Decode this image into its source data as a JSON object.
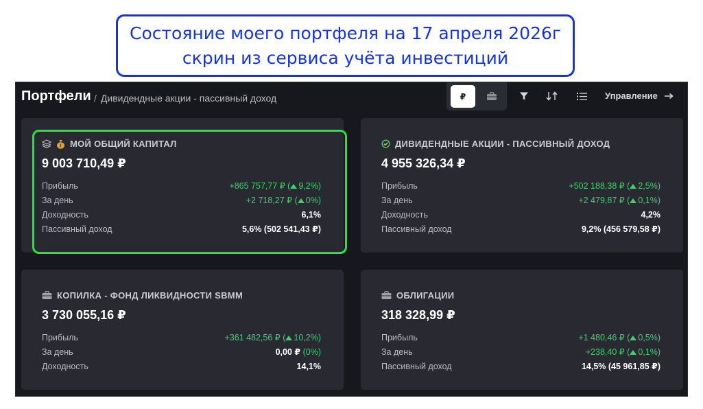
{
  "caption": {
    "line1": "Состояние моего портфеля на 17 апреля 2026г",
    "line2": "скрин из сервиса учёта инвестиций"
  },
  "header": {
    "title": "Портфели",
    "separator": "/",
    "breadcrumb": "Дивидендные акции - пассивный доход",
    "currency_button": "₽",
    "manage_label": "Управление"
  },
  "colors": {
    "positive": "#3ecf6e",
    "highlight": "#22e63a",
    "caption": "#1433e6"
  },
  "cards": [
    {
      "name": "МОЙ ОБЩИЙ КАПИТАЛ",
      "icons": [
        "layers-icon",
        "money-bag-icon"
      ],
      "total": "9 003 710,49 ₽",
      "rows": [
        {
          "label": "Прибыль",
          "value": "+865 757,77 ₽ (",
          "pct": "9,2%)",
          "arrow": true,
          "positive": true
        },
        {
          "label": "За день",
          "value": "+2 718,27 ₽ (",
          "pct": "0%)",
          "arrow": true,
          "positive": true
        },
        {
          "label": "Доходность",
          "value": "6,1%"
        },
        {
          "label": "Пассивный доход",
          "value": "5,6% (502 541,43 ₽)"
        }
      ]
    },
    {
      "name": "ДИВИДЕНДНЫЕ АКЦИИ - ПАССИВНЫЙ ДОХОД",
      "icons": [
        "check-circle-icon"
      ],
      "total": "4 955 326,34 ₽",
      "rows": [
        {
          "label": "Прибыль",
          "value": "+502 188,38 ₽ (",
          "pct": "2,5%)",
          "arrow": true,
          "positive": true
        },
        {
          "label": "За день",
          "value": "+2 479,87 ₽ (",
          "pct": "0,1%)",
          "arrow": true,
          "positive": true
        },
        {
          "label": "Доходность",
          "value": "4,2%"
        },
        {
          "label": "Пассивный доход",
          "value": "9,2% (456 579,58 ₽)"
        }
      ]
    },
    {
      "name": "КОПИЛКА - ФОНД ЛИКВИДНОСТИ SBMM",
      "icons": [
        "briefcase-icon"
      ],
      "total": "3 730 055,16 ₽",
      "rows": [
        {
          "label": "Прибыль",
          "value": "+361 482,56 ₽ (",
          "pct": "10,2%)",
          "arrow": true,
          "positive": true
        },
        {
          "label": "За день",
          "value": "0,00 ₽",
          "suffix": "(0%)"
        },
        {
          "label": "Доходность",
          "value": "14,1%"
        }
      ]
    },
    {
      "name": "ОБЛИГАЦИИ",
      "icons": [
        "briefcase-icon"
      ],
      "total": "318 328,99 ₽",
      "rows": [
        {
          "label": "Прибыль",
          "value": "+1 480,46 ₽ (",
          "pct": "0,5%)",
          "arrow": true,
          "positive": true
        },
        {
          "label": "За день",
          "value": "+238,40 ₽ (",
          "pct": "0,1%)",
          "arrow": true,
          "positive": true
        },
        {
          "label": "Пассивный доход",
          "value": "14,5% (45 961,85 ₽)"
        }
      ]
    }
  ]
}
